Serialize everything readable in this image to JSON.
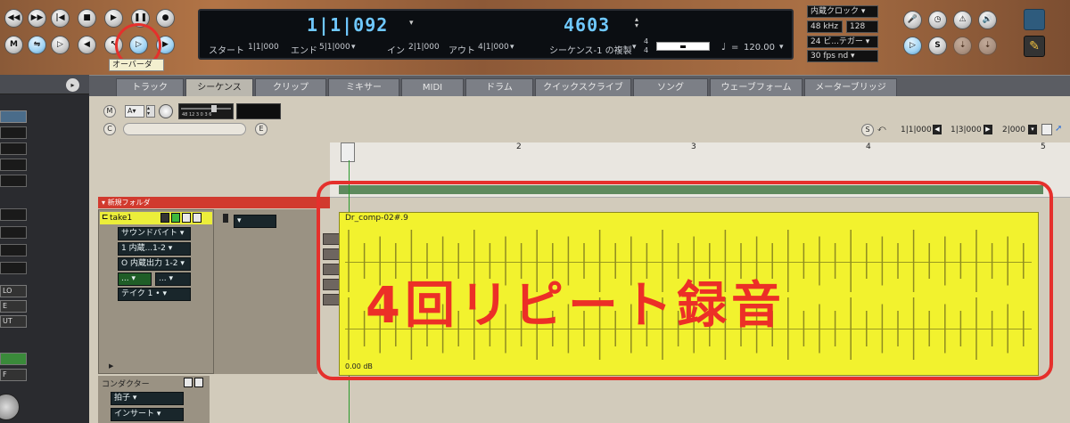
{
  "transport_buttons_row1": [
    "◀◀",
    "▶▶",
    "|◀",
    "■",
    "▶",
    "❚❚",
    "●"
  ],
  "transport_buttons_row2": [
    "M",
    "⇋",
    "▷",
    "◀",
    "↖",
    "▶",
    "▷",
    "▶"
  ],
  "tooltip": "オーバーダ",
  "display": {
    "position": "1|1|092",
    "tempo_val": "4603",
    "start_label": "スタート",
    "start_val": "1|1|000",
    "end_label": "エンド",
    "end_val": "5|1|000",
    "in_label": "イン",
    "in_val": "2|1|000",
    "out_label": "アウト",
    "out_val": "4|1|000",
    "sequence": "シーケンス-1 の複製",
    "time_sig_top": "4",
    "time_sig_bottom": "4",
    "note_symbol": "♩",
    "equals": "=",
    "tempo": "120.00"
  },
  "clock": {
    "source": "内蔵クロック",
    "rate": "48 kHz",
    "buffer": "128",
    "bits": "24 ビ...テガー",
    "fps": "30 fps nd"
  },
  "right_buttons": [
    "🎤",
    "◷",
    "⚠",
    "🔊",
    "▷",
    "S",
    "⇣",
    "⇣"
  ],
  "tabs": [
    "トラック",
    "シーケンス",
    "クリップ",
    "ミキサー",
    "MIDI",
    "ドラム",
    "クイックスクライブ",
    "ソング",
    "ウェーブフォーム",
    "メーターブリッジ"
  ],
  "active_tab": "シーケンス",
  "toolbar": {
    "m": "M",
    "a": "A",
    "c": "C",
    "e": "E",
    "meter_scale": "48 12  3 0 3 6"
  },
  "nav": {
    "s": "S",
    "pos1": "1|1|000",
    "pos2": "1|3|000",
    "pos3": "2|000"
  },
  "ruler_marks": [
    "2",
    "3",
    "4",
    "5"
  ],
  "folder_label": "新規フォルダ",
  "track": {
    "name": "take1",
    "device": "サウンドバイト",
    "input": "1 内蔵...1-2",
    "output": "O 内蔵出力 1-2",
    "take": "テイク 1 •",
    "green_a": "...",
    "green_b": "..."
  },
  "conductor": {
    "name": "コンダクター",
    "meter": "拍子",
    "insert": "インサート"
  },
  "clip": {
    "name": "Dr_comp-02#.9",
    "gain": "0.00 dB"
  },
  "annotation": "4回リピート録音",
  "left_rows": [
    "LO",
    "E",
    "UT",
    "F"
  ]
}
